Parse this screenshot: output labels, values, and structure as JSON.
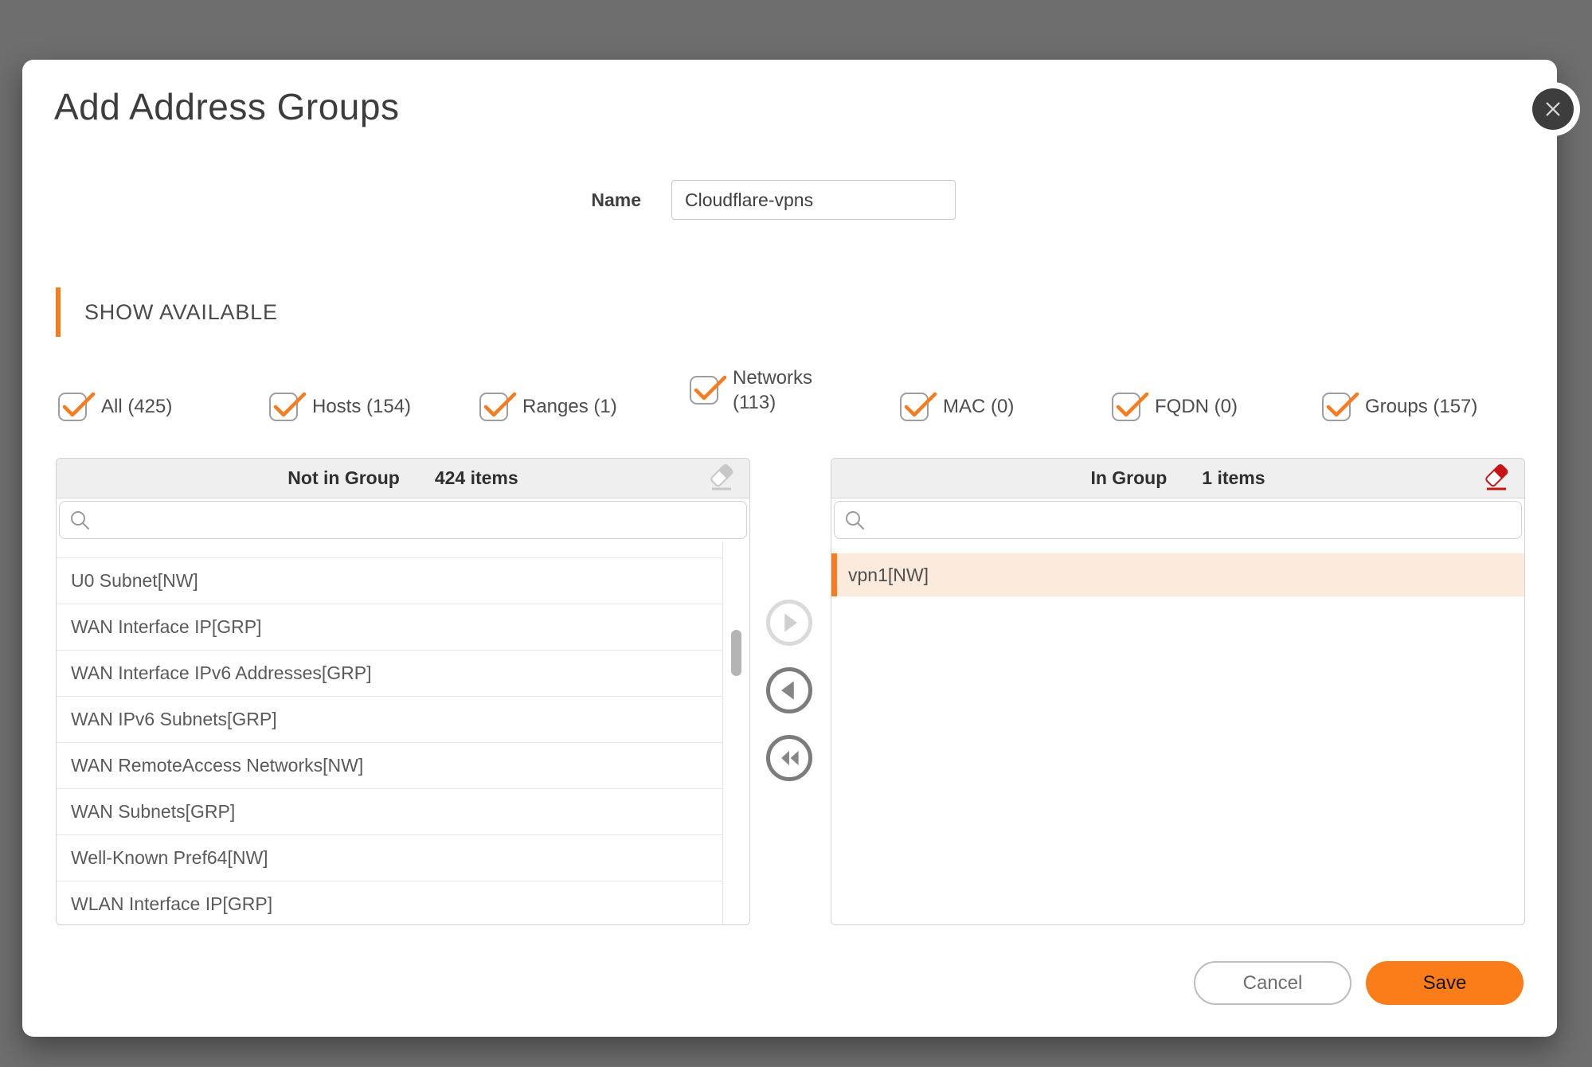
{
  "dialog": {
    "title": "Add Address Groups",
    "name_label": "Name",
    "name_value": "Cloudflare-vpns",
    "section_label": "SHOW AVAILABLE"
  },
  "filters": [
    "All (425)",
    "Hosts (154)",
    "Ranges (1)",
    "Networks (113)",
    "MAC (0)",
    "FQDN (0)",
    "Groups (157)"
  ],
  "left_panel": {
    "title": "Not in Group",
    "count": "424 items",
    "search_value": "",
    "items": [
      "U0 Subnet[NW]",
      "WAN Interface IP[GRP]",
      "WAN Interface IPv6 Addresses[GRP]",
      "WAN IPv6 Subnets[GRP]",
      "WAN RemoteAccess Networks[NW]",
      "WAN Subnets[GRP]",
      "Well-Known Pref64[NW]",
      "WLAN Interface IP[GRP]"
    ]
  },
  "right_panel": {
    "title": "In Group",
    "count": "1 items",
    "search_value": "",
    "items": [
      "vpn1[NW]"
    ]
  },
  "footer": {
    "cancel_label": "Cancel",
    "save_label": "Save"
  },
  "colors": {
    "accent_orange": "#f57d20",
    "save_orange": "#fa7d1a",
    "danger_red": "#c81414",
    "backdrop_gray": "#6e6e6e"
  }
}
